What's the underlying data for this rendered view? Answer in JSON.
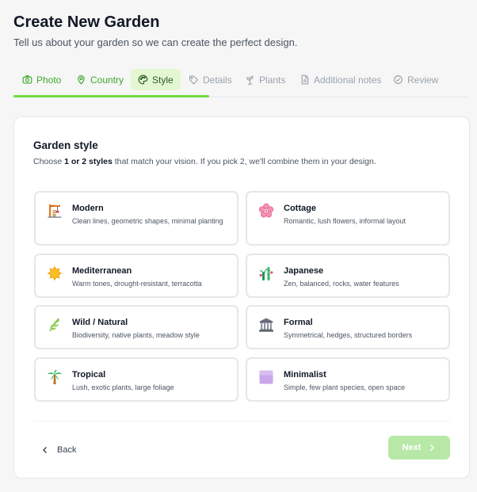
{
  "header": {
    "title": "Create New Garden",
    "subtitle": "Tell us about your garden so we can create the perfect design."
  },
  "tabs": [
    {
      "label": "Photo",
      "icon": "camera-icon",
      "state": "done"
    },
    {
      "label": "Country",
      "icon": "map-pin-icon",
      "state": "done"
    },
    {
      "label": "Style",
      "icon": "palette-icon",
      "state": "active"
    },
    {
      "label": "Details",
      "icon": "tag-icon",
      "state": "pending"
    },
    {
      "label": "Plants",
      "icon": "sprout-icon",
      "state": "pending"
    },
    {
      "label": "Additional notes",
      "icon": "document-icon",
      "state": "pending"
    },
    {
      "label": "Review",
      "icon": "check-circle-icon",
      "state": "pending"
    }
  ],
  "section": {
    "title": "Garden style",
    "desc_prefix": "Choose ",
    "desc_bold": "1 or 2 styles",
    "desc_suffix": " that match your vision. If you pick 2, we'll combine them in your design."
  },
  "styles": [
    {
      "title": "Modern",
      "desc": "Clean lines, geometric shapes, minimal planting",
      "icon": "building-crane-icon"
    },
    {
      "title": "Cottage",
      "desc": "Romantic, lush flowers, informal layout",
      "icon": "cherry-blossom-icon"
    },
    {
      "title": "Mediterranean",
      "desc": "Warm tones, drought-resistant, terracotta",
      "icon": "sun-icon"
    },
    {
      "title": "Japanese",
      "desc": "Zen, balanced, rocks, water features",
      "icon": "bamboo-icon"
    },
    {
      "title": "Wild / Natural",
      "desc": "Biodiversity, native plants, meadow style",
      "icon": "herb-icon"
    },
    {
      "title": "Formal",
      "desc": "Symmetrical, hedges, structured borders",
      "icon": "classical-building-icon"
    },
    {
      "title": "Tropical",
      "desc": "Lush, exotic plants, large foliage",
      "icon": "palm-tree-icon"
    },
    {
      "title": "Minimalist",
      "desc": "Simple, few plant species, open space",
      "icon": "purple-square-icon"
    }
  ],
  "footer": {
    "back_label": "Back",
    "next_label": "Next"
  },
  "colors": {
    "accent": "#6ddc3f",
    "accent_dark": "#3fa82d",
    "active_tab_bg": "#e3f7d2",
    "next_disabled": "#b8e8a8"
  }
}
